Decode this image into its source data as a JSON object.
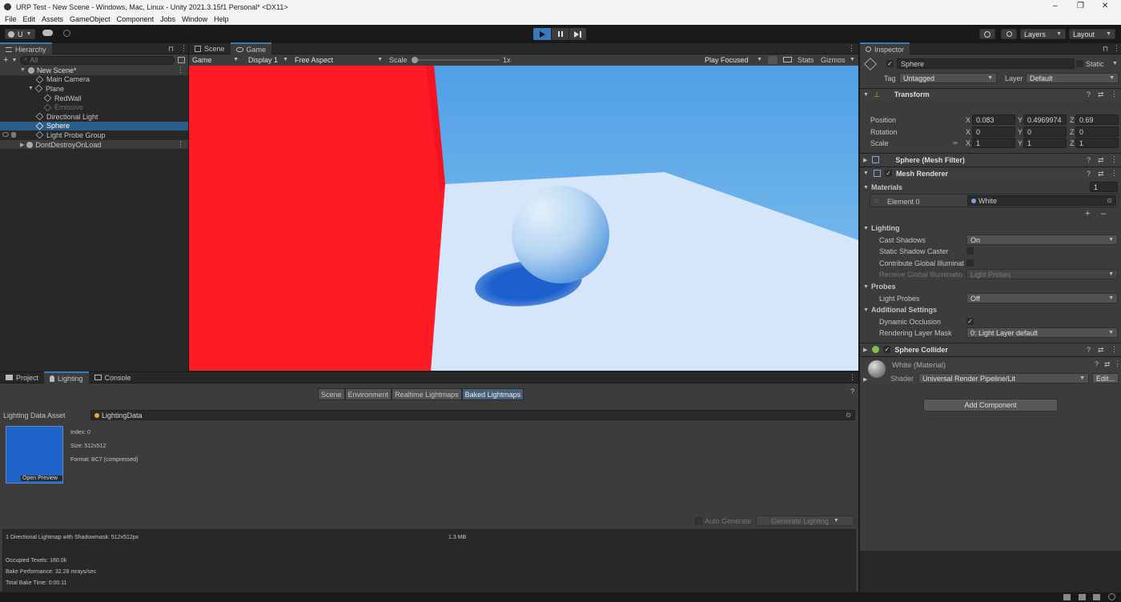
{
  "window": {
    "title": "URP Test - New Scene - Windows, Mac, Linux - Unity 2021.3.15f1 Personal* <DX11>",
    "controls": [
      "–",
      "❐",
      "✕"
    ]
  },
  "menu": [
    "File",
    "Edit",
    "Assets",
    "GameObject",
    "Component",
    "Jobs",
    "Window",
    "Help"
  ],
  "toolbar": {
    "account": "U",
    "layers": "Layers",
    "layout": "Layout"
  },
  "hierarchy": {
    "tab": "Hierarchy",
    "search_placeholder": "All",
    "items": [
      {
        "label": "New Scene*",
        "depth": 0,
        "bold": true
      },
      {
        "label": "Main Camera",
        "depth": 1
      },
      {
        "label": "Plane",
        "depth": 1
      },
      {
        "label": "RedWall",
        "depth": 2
      },
      {
        "label": "Emissive",
        "depth": 2,
        "dim": true
      },
      {
        "label": "Directional Light",
        "depth": 1
      },
      {
        "label": "Sphere",
        "depth": 1,
        "selected": true
      },
      {
        "label": "Light Probe Group",
        "depth": 1
      },
      {
        "label": "DontDestroyOnLoad",
        "depth": 0
      }
    ]
  },
  "view": {
    "tabs": [
      "Scene",
      "Game"
    ],
    "mode": "Game",
    "display": "Display 1",
    "aspect": "Free Aspect",
    "scale_label": "Scale",
    "scale_value": "1x",
    "play_focused": "Play Focused",
    "stats": "Stats",
    "gizmos": "Gizmos"
  },
  "inspector": {
    "tab": "Inspector",
    "object_name": "Sphere",
    "static_label": "Static",
    "tag_label": "Tag",
    "tag_value": "Untagged",
    "layer_label": "Layer",
    "layer_value": "Default",
    "transform": {
      "title": "Transform",
      "position_label": "Position",
      "rotation_label": "Rotation",
      "scale_label": "Scale",
      "position": {
        "x": "0.083",
        "y": "0.4969974",
        "z": "0.69"
      },
      "rotation": {
        "x": "0",
        "y": "0",
        "z": "0"
      },
      "scale": {
        "x": "1",
        "y": "1",
        "z": "1"
      }
    },
    "mesh_filter": "Sphere (Mesh Filter)",
    "mesh_renderer": {
      "title": "Mesh Renderer",
      "materials_label": "Materials",
      "materials_count": "1",
      "element_label": "Element 0",
      "element_value": "White",
      "lighting_label": "Lighting",
      "cast_shadows_label": "Cast Shadows",
      "cast_shadows_value": "On",
      "static_shadow_label": "Static Shadow Caster",
      "contribute_gi_label": "Contribute Global Illuminat",
      "receive_gi_label": "Receive Global Illuminatio",
      "receive_gi_value": "Light Probes",
      "probes_label": "Probes",
      "light_probes_label": "Light Probes",
      "light_probes_value": "Off",
      "additional_label": "Additional Settings",
      "dynamic_occlusion_label": "Dynamic Occlusion",
      "rendering_layer_label": "Rendering Layer Mask",
      "rendering_layer_value": "0: Light Layer default"
    },
    "sphere_collider": "Sphere Collider",
    "material": {
      "name": "White (Material)",
      "shader_label": "Shader",
      "shader_value": "Universal Render Pipeline/Lit",
      "edit": "Edit..."
    },
    "add_component": "Add Component"
  },
  "bottom": {
    "tabs": [
      "Project",
      "Lighting",
      "Console"
    ],
    "subtabs": [
      "Scene",
      "Environment",
      "Realtime Lightmaps",
      "Baked Lightmaps"
    ],
    "lighting_data_label": "Lighting Data Asset",
    "lighting_data_value": "LightingData",
    "lightmap": {
      "index": "Index: 0",
      "size": "Size: 512x512",
      "format": "Format: BC7 (compressed)",
      "open_preview": "Open Preview"
    },
    "auto_generate": "Auto Generate",
    "generate": "Generate Lighting",
    "stats": {
      "line1": "1 Directional Lightmap with Shadowmask: 512x512px",
      "line1_size": "1.3 MB",
      "texels": "Occupied Texels: 160.0k",
      "bake_perf": "Bake Performance: 32.28 mrays/sec",
      "bake_time": "Total Bake Time: 0:00:11"
    }
  },
  "colors": {
    "accent": "#3a79bb",
    "selection": "#2c5d87",
    "red_wall": "#ff1b26",
    "lightmap": "#1e63c7"
  }
}
